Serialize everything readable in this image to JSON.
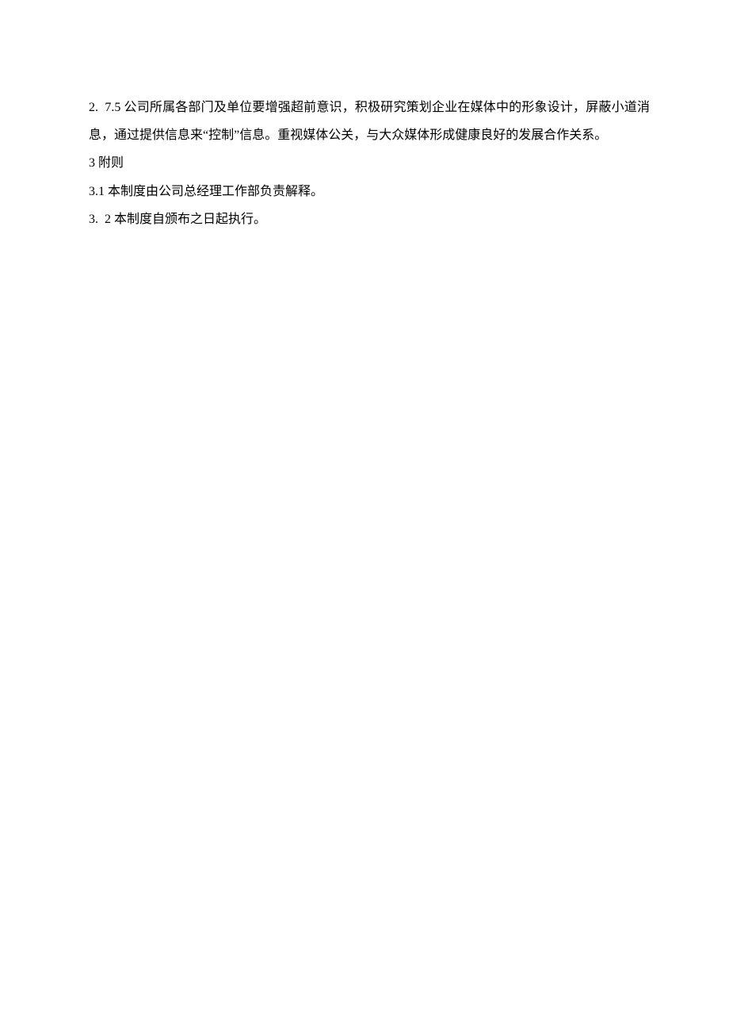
{
  "paragraphs": {
    "p1": "2.  7.5 公司所属各部门及单位要增强超前意识，积极研究策划企业在媒体中的形象设计，屏蔽小道消息，通过提供信息来“控制”信息。重视媒体公关，与大众媒体形成健康良好的发展合作关系。",
    "p2": "3 附则",
    "p3": "3.1 本制度由公司总经理工作部负责解释。",
    "p4": "3.  2 本制度自颁布之日起执行。"
  }
}
